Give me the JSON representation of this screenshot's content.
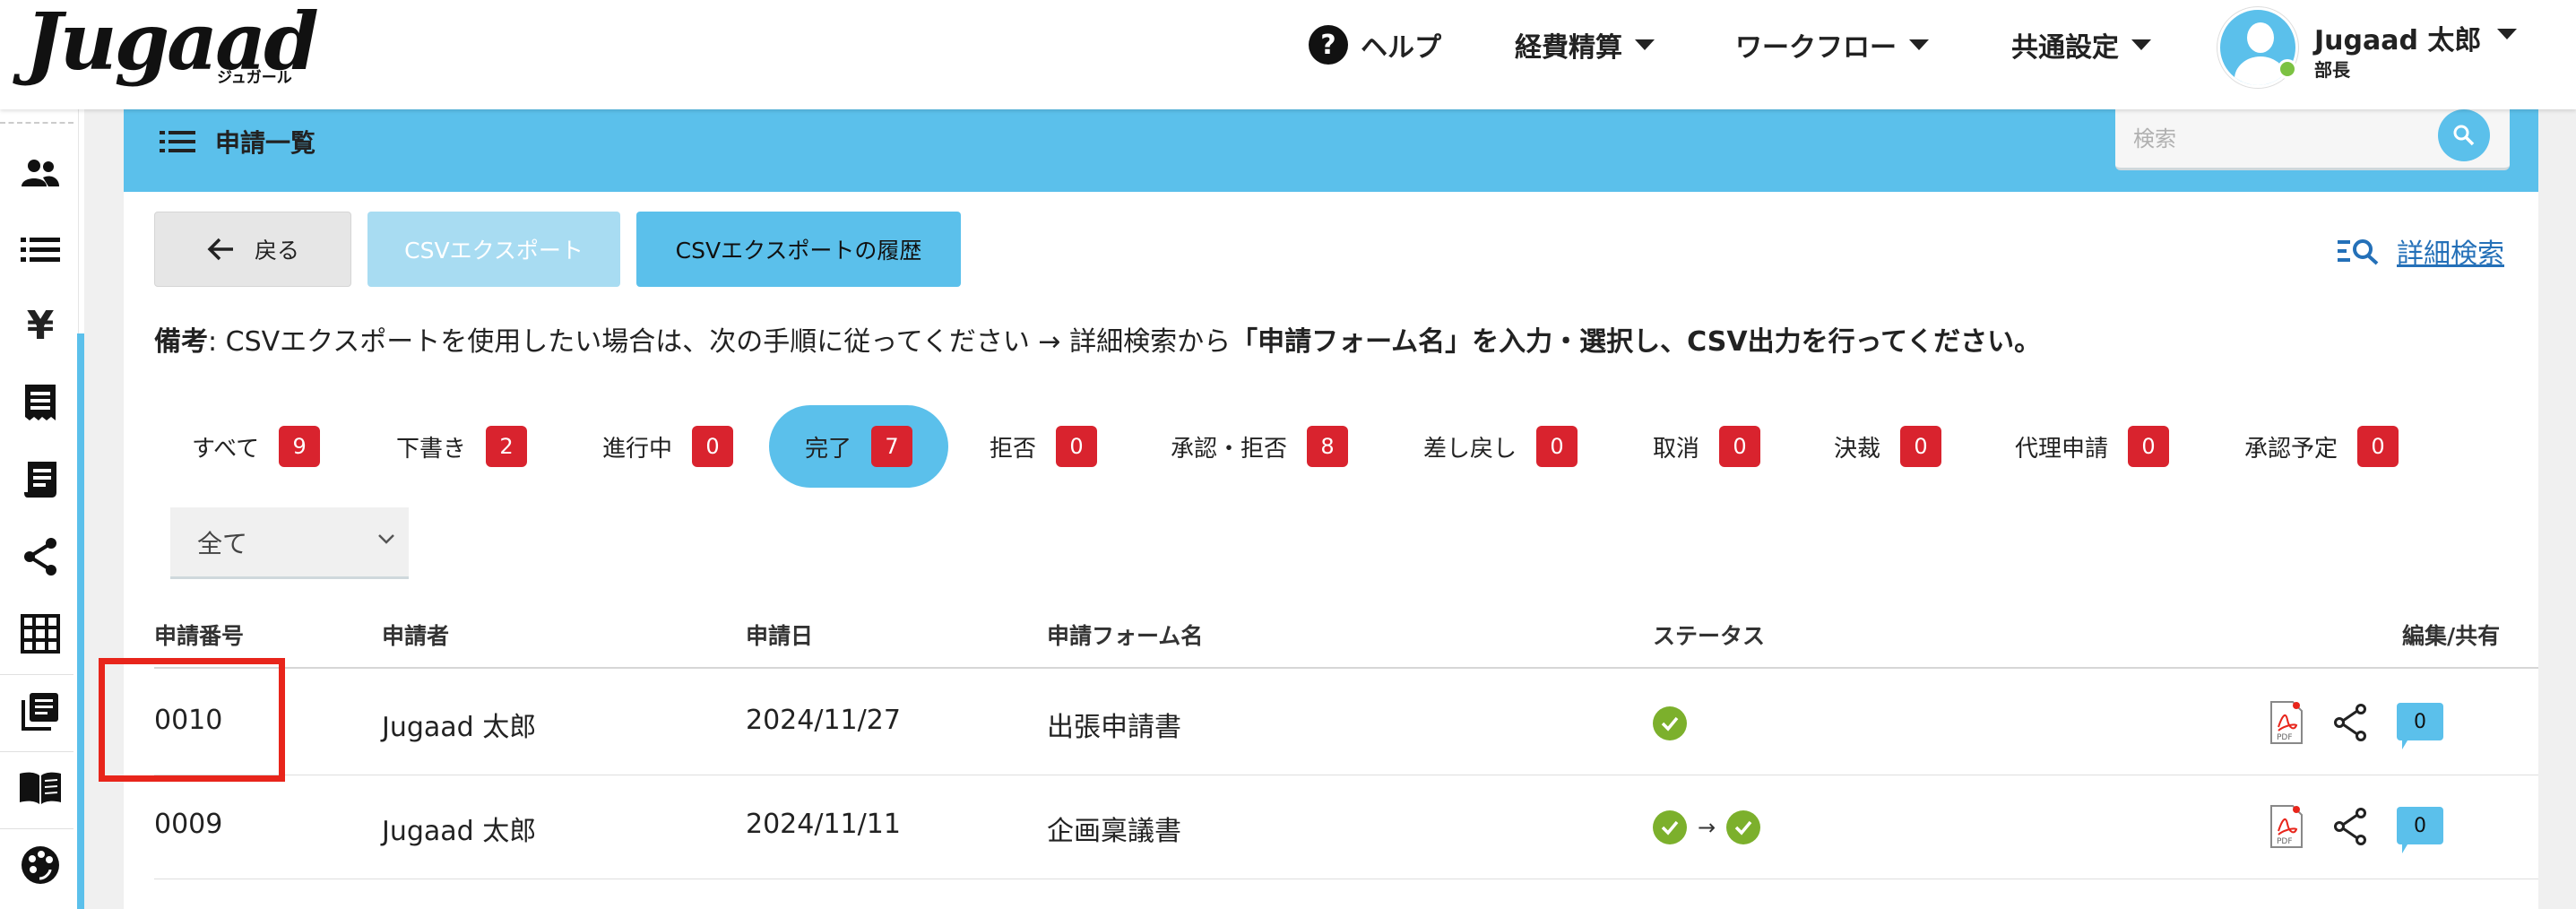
{
  "header": {
    "logo_text": "Jugaad",
    "logo_sub": "ジュガール",
    "nav": {
      "help": "ヘルプ",
      "expense": "経費精算",
      "workflow": "ワークフロー",
      "common": "共通設定"
    },
    "user": {
      "name": "Jugaad 太郎",
      "role": "部長"
    }
  },
  "sidebar": {
    "icons": [
      "people-icon",
      "list-icon",
      "yen-icon",
      "receipt-icon",
      "document-icon",
      "share-icon",
      "grid-icon",
      "library-icon",
      "book-icon",
      "palette-icon"
    ]
  },
  "panel": {
    "title": "申請一覧",
    "search_placeholder": "検索"
  },
  "toolbar": {
    "back": "戻る",
    "csv_export": "CSVエクスポート",
    "csv_history": "CSVエクスポートの履歴",
    "advanced_search": "詳細検索"
  },
  "note": {
    "label": "備考",
    "text": ": CSVエクスポートを使用したい場合は、次の手順に従ってください → 詳細検索から",
    "bold": "「申請フォーム名」を入力・選択し、CSV出力を行ってください。"
  },
  "tabs": [
    {
      "label": "すべて",
      "count": "9"
    },
    {
      "label": "下書き",
      "count": "2"
    },
    {
      "label": "進行中",
      "count": "0"
    },
    {
      "label": "完了",
      "count": "7"
    },
    {
      "label": "拒否",
      "count": "0"
    },
    {
      "label": "承認・拒否",
      "count": "8"
    },
    {
      "label": "差し戻し",
      "count": "0"
    },
    {
      "label": "取消",
      "count": "0"
    },
    {
      "label": "決裁",
      "count": "0"
    },
    {
      "label": "代理申請",
      "count": "0"
    },
    {
      "label": "承認予定",
      "count": "0"
    }
  ],
  "active_tab": "完了",
  "filter": {
    "selected": "全て"
  },
  "table": {
    "headers": {
      "number": "申請番号",
      "applicant": "申請者",
      "date": "申請日",
      "form": "申請フォーム名",
      "status": "ステータス",
      "actions": "編集/共有"
    },
    "rows": [
      {
        "number": "0010",
        "applicant": "Jugaad 太郎",
        "date": "2024/11/27",
        "form": "出張申請書",
        "status_steps": 1,
        "comments": "0"
      },
      {
        "number": "0009",
        "applicant": "Jugaad 太郎",
        "date": "2024/11/11",
        "form": "企画稟議書",
        "status_steps": 2,
        "comments": "0"
      }
    ]
  },
  "colors": {
    "accent": "#5bc0eb",
    "badge": "#d9232e",
    "check": "#7cb02c",
    "highlight": "#e8251b",
    "link": "#2470b8"
  }
}
